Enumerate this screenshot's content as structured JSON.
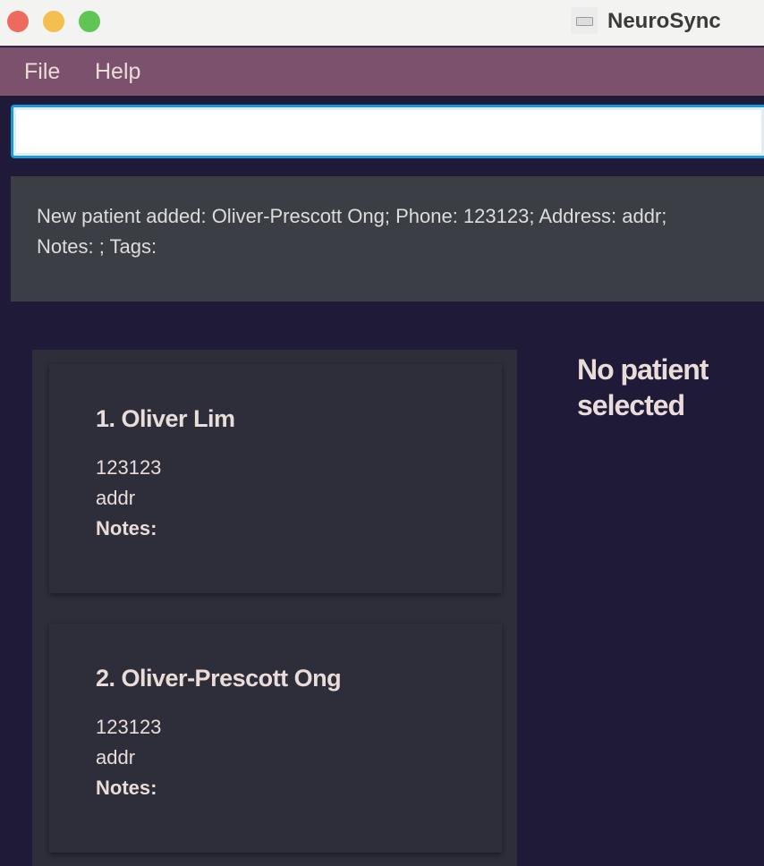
{
  "window": {
    "title": "NeuroSync",
    "controls": {
      "close": "#ee6a5f",
      "minimize": "#f5bf4f",
      "maximize": "#61c554"
    }
  },
  "menu": {
    "file": "File",
    "help": "Help"
  },
  "command": {
    "value": ""
  },
  "result": {
    "line1": "New patient added: Oliver-Prescott Ong; Phone: 123123; Address: addr;",
    "line2": "Notes: ; Tags:"
  },
  "patients": [
    {
      "name": "1.  Oliver Lim",
      "phone": "123123",
      "address": "addr",
      "notes_label": "Notes:"
    },
    {
      "name": "2.  Oliver-Prescott Ong",
      "phone": "123123",
      "address": "addr",
      "notes_label": "Notes:"
    }
  ],
  "detail": {
    "empty": "No patient selected"
  }
}
